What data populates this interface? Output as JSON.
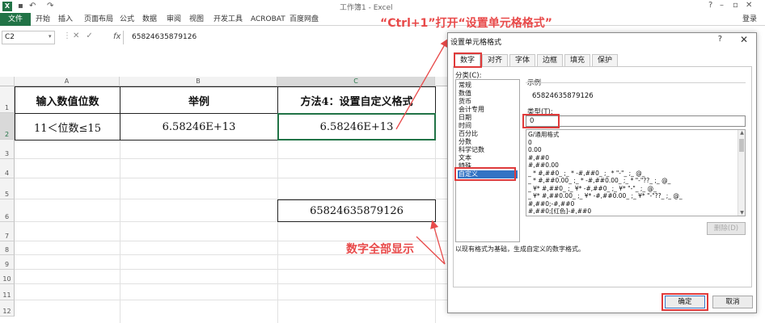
{
  "app": {
    "window_title": "工作簿1 - Excel",
    "logo": "X",
    "login": "登录"
  },
  "ribbon_tabs": [
    "文件",
    "开始",
    "插入",
    "页面布局",
    "公式",
    "数据",
    "审阅",
    "视图",
    "开发工具",
    "ACROBAT",
    "百度网盘"
  ],
  "formula_bar": {
    "name_box": "C2",
    "fx": "fx",
    "value": "65824635879126"
  },
  "columns": [
    "A",
    "B",
    "C"
  ],
  "rows": [
    "1",
    "2",
    "3",
    "4",
    "5",
    "6",
    "7",
    "8",
    "9",
    "10",
    "11",
    "12"
  ],
  "cells": {
    "a1": "输入数值位数",
    "b1": "举例",
    "c1": "方法4：设置自定义格式",
    "a2": "11＜位数≤15",
    "b2": "6.58246E+13",
    "c2": "6.58246E+13",
    "c6": "65824635879126"
  },
  "annotations": {
    "top": "“Ctrl+1”打开“设置单元格格式”",
    "bottom": "数字全部显示"
  },
  "dialog": {
    "title": "设置单元格格式",
    "help": "?",
    "close": "✕",
    "tabs": [
      "数字",
      "对齐",
      "字体",
      "边框",
      "填充",
      "保护"
    ],
    "category_label": "分类(C):",
    "categories": [
      "常规",
      "数值",
      "货币",
      "会计专用",
      "日期",
      "时间",
      "百分比",
      "分数",
      "科学记数",
      "文本",
      "特殊",
      "自定义"
    ],
    "selected_category": "自定义",
    "sample_label": "示例",
    "sample_value": "65824635879126",
    "type_label": "类型(T):",
    "type_value": "0",
    "type_list": [
      "G/通用格式",
      "0",
      "0.00",
      "#,##0",
      "#,##0.00",
      "_ * #,##0_ ;_ * -#,##0_ ;_ * \"-\"_ ;_ @_",
      "_ * #,##0.00_ ;_ * -#,##0.00_ ;_ * \"-\"??_ ;_ @_",
      "_ ¥* #,##0_ ;_ ¥* -#,##0_ ;_ ¥* \"-\"_ ;_ @_",
      "_ ¥* #,##0.00_ ;_ ¥* -#,##0.00_ ;_ ¥* \"-\"??_ ;_ @_",
      "#,##0;-#,##0",
      "#,##0;[红色]-#,##0"
    ],
    "delete_label": "删除(D)",
    "description": "以现有格式为基础，生成自定义的数字格式。",
    "ok_label": "确定",
    "cancel_label": "取消"
  },
  "colors": {
    "excel_green": "#217346",
    "annotation_red": "#e84a4a",
    "selection_blue": "#3373c4"
  }
}
